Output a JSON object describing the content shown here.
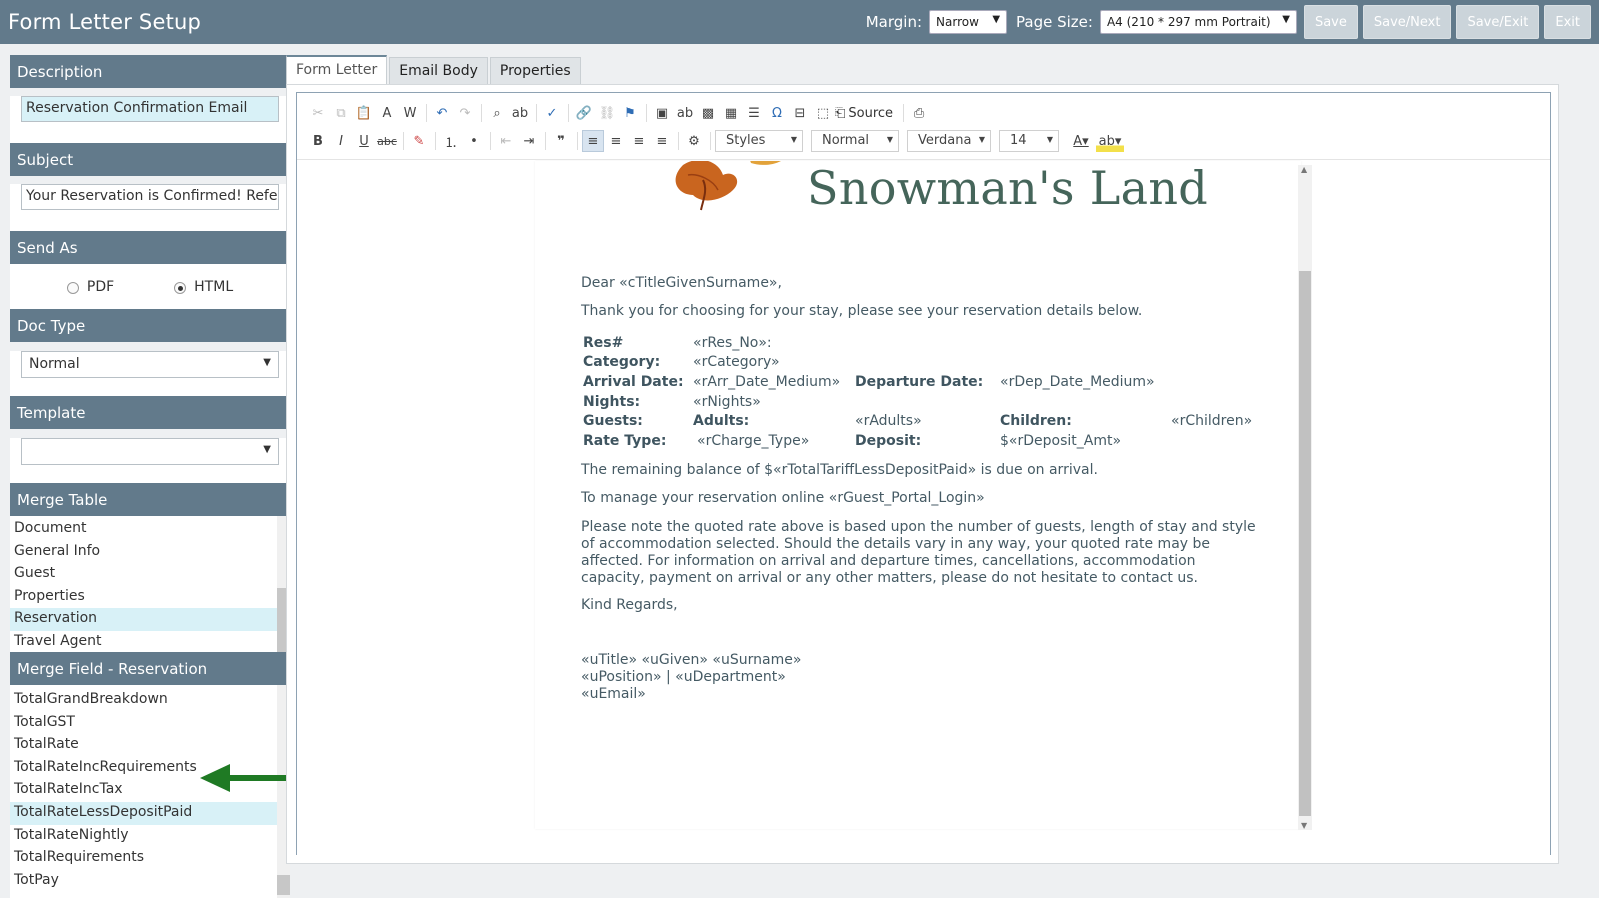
{
  "app": {
    "title": "Form Letter Setup",
    "margin_label": "Margin:",
    "margin_value": "Narrow",
    "page_size_label": "Page Size:",
    "page_size_value": "A4 (210 * 297 mm Portrait)",
    "buttons": {
      "save": "Save",
      "save_next": "Save/Next",
      "save_exit": "Save/Exit",
      "exit": "Exit"
    }
  },
  "left": {
    "description_head": "Description",
    "description_value": "Reservation Confirmation Email",
    "subject_head": "Subject",
    "subject_value": "Your Reservation is Confirmed! Reference",
    "send_as_head": "Send As",
    "send_as_pdf": "PDF",
    "send_as_html": "HTML",
    "doc_type_head": "Doc Type",
    "doc_type_value": "Normal",
    "template_head": "Template",
    "template_value": "",
    "merge_table_head": "Merge Table",
    "merge_tables": [
      "Document",
      "General Info",
      "Guest",
      "Properties",
      "Reservation",
      "Travel Agent"
    ],
    "merge_field_head": "Merge Field - Reservation",
    "merge_fields": [
      "TotalGrandBreakdown",
      "TotalGST",
      "TotalRate",
      "TotalRateIncRequirements",
      "TotalRateIncTax",
      "TotalRateLessDepositPaid",
      "TotalRateNightly",
      "TotalRequirements",
      "TotPay"
    ]
  },
  "tabs": [
    "Form Letter",
    "Email Body",
    "Properties"
  ],
  "toolbar": {
    "source_label": "Source",
    "styles": "Styles",
    "format": "Normal",
    "font": "Verdana",
    "size": "14"
  },
  "doc": {
    "letterhead": "Snowman's Land",
    "greeting": "Dear «cTitleGivenSurname»,",
    "intro": "Thank you for choosing  for your stay, please see your reservation details below.",
    "rows": {
      "res_label": "Res#",
      "res_val": "«rRes_No»:",
      "cat_label": "Category:",
      "cat_val": "«rCategory»",
      "arr_label": "Arrival Date:",
      "arr_val": "«rArr_Date_Medium»",
      "dep_label": "Departure Date:",
      "dep_val": "«rDep_Date_Medium»",
      "nights_label": "Nights:",
      "nights_val": "«rNights»",
      "guests_label": "Guests:",
      "adults_label": "Adults:",
      "adults_val": "«rAdults»",
      "children_label": "Children:",
      "children_val": "«rChildren»",
      "rate_label": "Rate Type:",
      "rate_val": "«rCharge_Type»",
      "deposit_label": "Deposit:",
      "deposit_val": "$«rDeposit_Amt»"
    },
    "balance": "The remaining balance of $«rTotalTariffLessDepositPaid» is due on arrival.",
    "manage": "To manage your reservation online «rGuest_Portal_Login»",
    "note": "Please note the quoted rate above is based upon the number of guests, length of stay and style of accommodation selected. Should the details vary in any way, your quoted rate may be affected. For information on arrival and departure times, cancellations, accommodation capacity, payment on arrival or any other matters, please do not hesitate to contact us.",
    "regards": "Kind Regards,",
    "sig1": "«uTitle» «uGiven» «uSurname»",
    "sig2": "«uPosition» | «uDepartment»",
    "sig3": "«uEmail»"
  },
  "colors": {
    "header": "#627a8b",
    "selected": "#d8f1f7",
    "arrow": "#1f7a24",
    "letterhead": "#45655a"
  }
}
